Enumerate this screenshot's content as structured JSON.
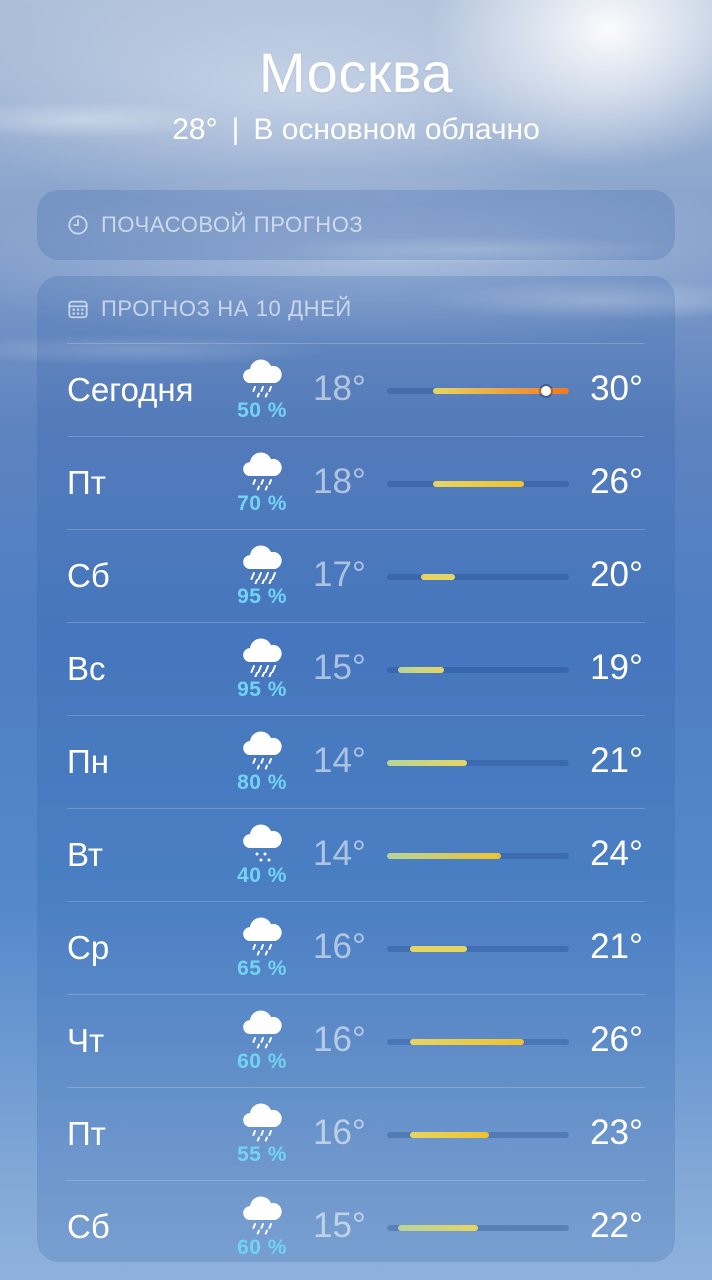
{
  "header": {
    "city": "Москва",
    "current_temp": "28°",
    "separator": "|",
    "condition": "В основном облачно"
  },
  "hourly": {
    "title": "ПОЧАСОВОЙ ПРОГНОЗ",
    "icon": "clock-icon"
  },
  "daily": {
    "title": "ПРОГНОЗ НА 10 ДНЕЙ",
    "icon": "calendar-icon",
    "scale_min": 14,
    "scale_max": 30,
    "current_temp_value": 28,
    "days": [
      {
        "day": "Сегодня",
        "precip": "50 %",
        "low": "18°",
        "high": "30°",
        "low_value": 18,
        "high_value": 30,
        "icon": "cloud-rain-icon"
      },
      {
        "day": "Пт",
        "precip": "70 %",
        "low": "18°",
        "high": "26°",
        "low_value": 18,
        "high_value": 26,
        "icon": "cloud-rain-icon"
      },
      {
        "day": "Сб",
        "precip": "95 %",
        "low": "17°",
        "high": "20°",
        "low_value": 17,
        "high_value": 20,
        "icon": "cloud-heavy-rain-icon"
      },
      {
        "day": "Вс",
        "precip": "95 %",
        "low": "15°",
        "high": "19°",
        "low_value": 15,
        "high_value": 19,
        "icon": "cloud-heavy-rain-icon"
      },
      {
        "day": "Пн",
        "precip": "80 %",
        "low": "14°",
        "high": "21°",
        "low_value": 14,
        "high_value": 21,
        "icon": "cloud-rain-icon"
      },
      {
        "day": "Вт",
        "precip": "40 %",
        "low": "14°",
        "high": "24°",
        "low_value": 14,
        "high_value": 24,
        "icon": "cloud-drizzle-icon"
      },
      {
        "day": "Ср",
        "precip": "65 %",
        "low": "16°",
        "high": "21°",
        "low_value": 16,
        "high_value": 21,
        "icon": "cloud-rain-icon"
      },
      {
        "day": "Чт",
        "precip": "60 %",
        "low": "16°",
        "high": "26°",
        "low_value": 16,
        "high_value": 26,
        "icon": "cloud-rain-icon"
      },
      {
        "day": "Пт",
        "precip": "55 %",
        "low": "16°",
        "high": "23°",
        "low_value": 16,
        "high_value": 23,
        "icon": "cloud-rain-icon"
      },
      {
        "day": "Сб",
        "precip": "60 %",
        "low": "15°",
        "high": "22°",
        "low_value": 15,
        "high_value": 22,
        "icon": "cloud-rain-icon"
      }
    ]
  },
  "colors": {
    "precip_text": "#72d3f6",
    "cool": "#b7d59a",
    "mild": "#e6d563",
    "warm": "#f0c22e",
    "hot": "#f39a2c",
    "hotter": "#ef7a25"
  }
}
